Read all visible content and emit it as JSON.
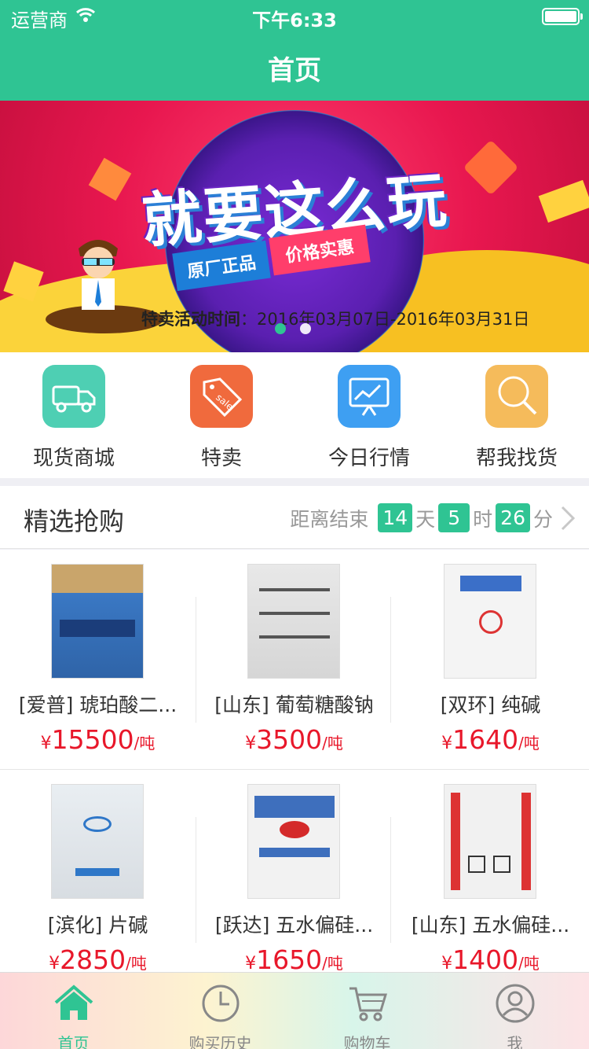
{
  "status": {
    "carrier": "运营商",
    "time": "下午6:33"
  },
  "nav": {
    "title": "首页"
  },
  "banner": {
    "headline": "就要这么玩",
    "tag1": "原厂正品",
    "tag2": "价格实惠",
    "date_label": "特卖活动时间",
    "date_range": "：2016年03月07日-2016年03月31日"
  },
  "categories": [
    {
      "label": "现货商城",
      "icon": "truck-icon",
      "color": "#4ecfb3"
    },
    {
      "label": "特卖",
      "icon": "sale-tag-icon",
      "color": "#f06a3d"
    },
    {
      "label": "今日行情",
      "icon": "chart-board-icon",
      "color": "#3e9ff2"
    },
    {
      "label": "帮我找货",
      "icon": "search-icon",
      "color": "#f5bb5b"
    }
  ],
  "flash": {
    "title": "精选抢购",
    "end_label": "距离结束",
    "days": "14",
    "days_unit": "天",
    "hours": "5",
    "hours_unit": "时",
    "minutes": "26",
    "minutes_unit": "分"
  },
  "products": [
    {
      "name": "[爱普] 琥珀酸二...",
      "yen": "¥",
      "price": "15500",
      "unit": "/吨",
      "img_color": "#3a78c4"
    },
    {
      "name": "[山东] 葡萄糖酸钠",
      "yen": "¥",
      "price": "3500",
      "unit": "/吨",
      "img_color": "#efefef"
    },
    {
      "name": "[双环] 纯碱",
      "yen": "¥",
      "price": "1640",
      "unit": "/吨",
      "img_color": "#f4f4f4"
    },
    {
      "name": "[滨化] 片碱",
      "yen": "¥",
      "price": "2850",
      "unit": "/吨",
      "img_color": "#e9eef2"
    },
    {
      "name": "[跃达] 五水偏硅...",
      "yen": "¥",
      "price": "1650",
      "unit": "/吨",
      "img_color": "#f2f2f2"
    },
    {
      "name": "[山东] 五水偏硅...",
      "yen": "¥",
      "price": "1400",
      "unit": "/吨",
      "img_color": "#f1f1f1"
    }
  ],
  "tabs": [
    {
      "label": "首页",
      "icon": "home-icon",
      "active": true
    },
    {
      "label": "购买历史",
      "icon": "clock-icon",
      "active": false
    },
    {
      "label": "购物车",
      "icon": "cart-icon",
      "active": false
    },
    {
      "label": "我",
      "icon": "user-icon",
      "active": false
    }
  ],
  "colors": {
    "accent": "#2fc493",
    "price": "#e8172a"
  }
}
